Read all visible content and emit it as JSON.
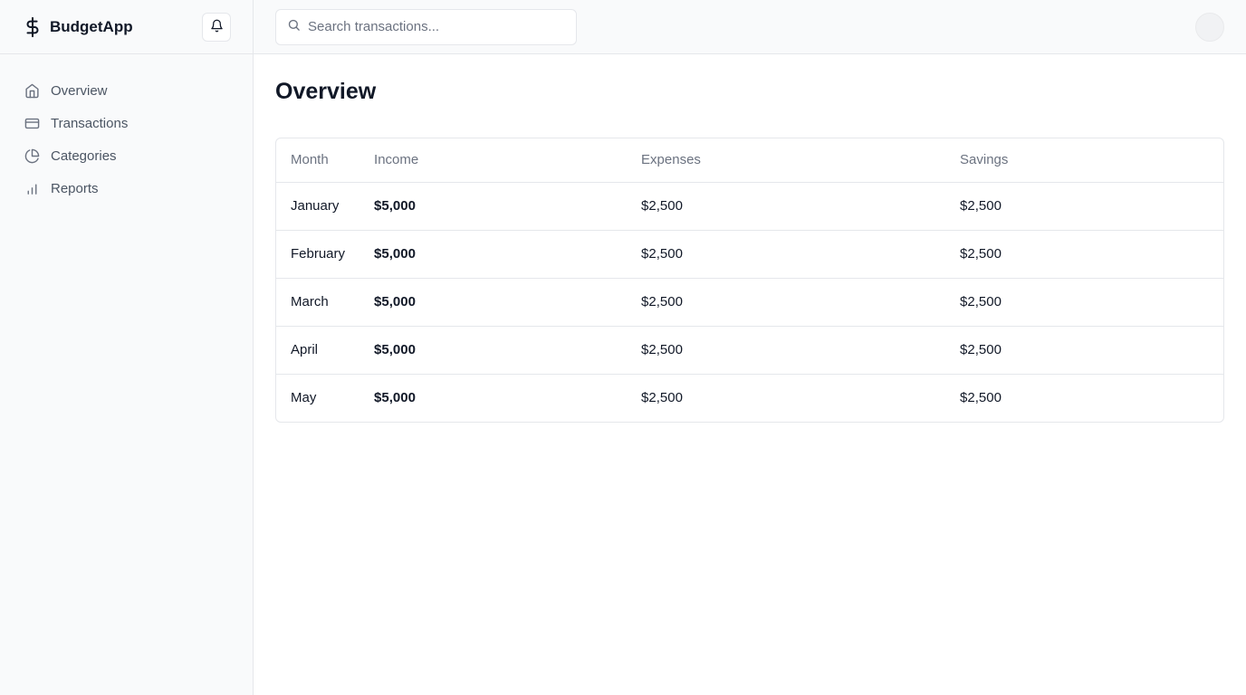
{
  "brand": {
    "name": "BudgetApp"
  },
  "sidebar": {
    "items": [
      {
        "label": "Overview",
        "icon": "home-icon"
      },
      {
        "label": "Transactions",
        "icon": "credit-card-icon"
      },
      {
        "label": "Categories",
        "icon": "pie-chart-icon"
      },
      {
        "label": "Reports",
        "icon": "bar-chart-icon"
      }
    ]
  },
  "search": {
    "placeholder": "Search transactions..."
  },
  "page": {
    "title": "Overview"
  },
  "table": {
    "headers": {
      "month": "Month",
      "income": "Income",
      "expenses": "Expenses",
      "savings": "Savings"
    },
    "rows": [
      {
        "month": "January",
        "income": "$5,000",
        "expenses": "$2,500",
        "savings": "$2,500"
      },
      {
        "month": "February",
        "income": "$5,000",
        "expenses": "$2,500",
        "savings": "$2,500"
      },
      {
        "month": "March",
        "income": "$5,000",
        "expenses": "$2,500",
        "savings": "$2,500"
      },
      {
        "month": "April",
        "income": "$5,000",
        "expenses": "$2,500",
        "savings": "$2,500"
      },
      {
        "month": "May",
        "income": "$5,000",
        "expenses": "$2,500",
        "savings": "$2,500"
      }
    ]
  },
  "colors": {
    "sidebar_bg": "#f9fafb",
    "border": "#e5e7eb",
    "text_primary": "#111827",
    "text_muted": "#6b7280",
    "nav_text": "#4b5563"
  }
}
